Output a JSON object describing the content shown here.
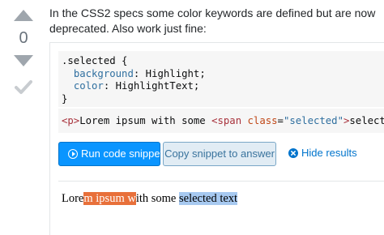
{
  "vote": {
    "count": "0"
  },
  "answer": {
    "intro": "In the CSS2 specs some color keywords are defined but are now deprecated. Also work just fine:"
  },
  "snippet": {
    "css_lines": [
      ".selected {",
      "background",
      "Highlight",
      "color",
      "HighlightText",
      "}"
    ],
    "html": {
      "open_p": "<p>",
      "text1": "Lorem ipsum with some ",
      "open_span": "<span ",
      "attr_name": "class",
      "eq": "=",
      "attr_value": "\"selected\"",
      "close_tag": ">",
      "text2": "selected text"
    },
    "buttons": {
      "run": "Run code snippet",
      "copy": "Copy snippet to answer",
      "hide": "Hide results"
    },
    "result": {
      "part1": "Lore",
      "highlight_orange": "m ipsum w",
      "part2": "ith some ",
      "highlight_blue": "selected text"
    }
  },
  "colors": {
    "run_button": "#0a95ff",
    "copy_button_bg": "#e1ecf4",
    "hide_link": "#0074cc",
    "orange_selection": "#e8703a",
    "blue_selection": "#a7c9f0"
  }
}
